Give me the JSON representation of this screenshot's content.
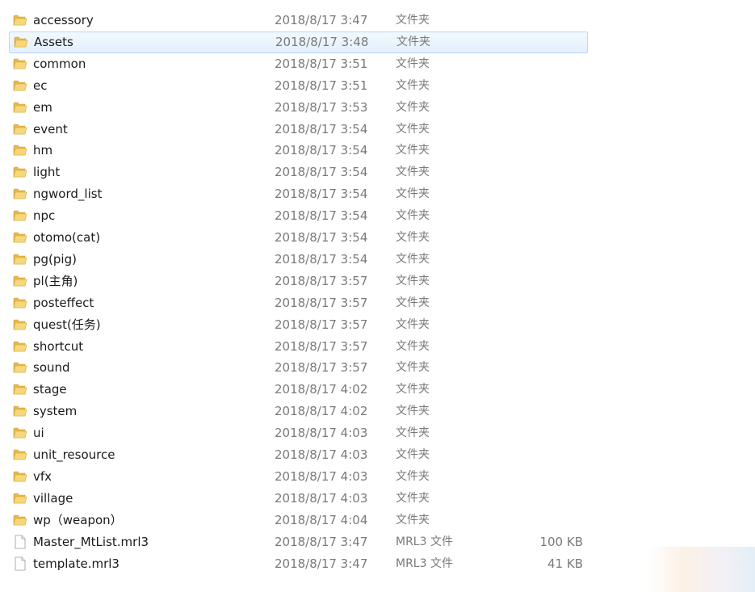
{
  "rows": [
    {
      "name": "accessory",
      "date": "2018/8/17 3:47",
      "type": "文件夹",
      "size": "",
      "kind": "folder",
      "selected": false
    },
    {
      "name": "Assets",
      "date": "2018/8/17 3:48",
      "type": "文件夹",
      "size": "",
      "kind": "folder",
      "selected": true
    },
    {
      "name": "common",
      "date": "2018/8/17 3:51",
      "type": "文件夹",
      "size": "",
      "kind": "folder",
      "selected": false
    },
    {
      "name": "ec",
      "date": "2018/8/17 3:51",
      "type": "文件夹",
      "size": "",
      "kind": "folder",
      "selected": false
    },
    {
      "name": "em",
      "date": "2018/8/17 3:53",
      "type": "文件夹",
      "size": "",
      "kind": "folder",
      "selected": false
    },
    {
      "name": "event",
      "date": "2018/8/17 3:54",
      "type": "文件夹",
      "size": "",
      "kind": "folder",
      "selected": false
    },
    {
      "name": "hm",
      "date": "2018/8/17 3:54",
      "type": "文件夹",
      "size": "",
      "kind": "folder",
      "selected": false
    },
    {
      "name": "light",
      "date": "2018/8/17 3:54",
      "type": "文件夹",
      "size": "",
      "kind": "folder",
      "selected": false
    },
    {
      "name": "ngword_list",
      "date": "2018/8/17 3:54",
      "type": "文件夹",
      "size": "",
      "kind": "folder",
      "selected": false
    },
    {
      "name": "npc",
      "date": "2018/8/17 3:54",
      "type": "文件夹",
      "size": "",
      "kind": "folder",
      "selected": false
    },
    {
      "name": "otomo(cat)",
      "date": "2018/8/17 3:54",
      "type": "文件夹",
      "size": "",
      "kind": "folder",
      "selected": false
    },
    {
      "name": "pg(pig)",
      "date": "2018/8/17 3:54",
      "type": "文件夹",
      "size": "",
      "kind": "folder",
      "selected": false
    },
    {
      "name": "pl(主角)",
      "date": "2018/8/17 3:57",
      "type": "文件夹",
      "size": "",
      "kind": "folder",
      "selected": false
    },
    {
      "name": "posteffect",
      "date": "2018/8/17 3:57",
      "type": "文件夹",
      "size": "",
      "kind": "folder",
      "selected": false
    },
    {
      "name": "quest(任务)",
      "date": "2018/8/17 3:57",
      "type": "文件夹",
      "size": "",
      "kind": "folder",
      "selected": false
    },
    {
      "name": "shortcut",
      "date": "2018/8/17 3:57",
      "type": "文件夹",
      "size": "",
      "kind": "folder",
      "selected": false
    },
    {
      "name": "sound",
      "date": "2018/8/17 3:57",
      "type": "文件夹",
      "size": "",
      "kind": "folder",
      "selected": false
    },
    {
      "name": "stage",
      "date": "2018/8/17 4:02",
      "type": "文件夹",
      "size": "",
      "kind": "folder",
      "selected": false
    },
    {
      "name": "system",
      "date": "2018/8/17 4:02",
      "type": "文件夹",
      "size": "",
      "kind": "folder",
      "selected": false
    },
    {
      "name": "ui",
      "date": "2018/8/17 4:03",
      "type": "文件夹",
      "size": "",
      "kind": "folder",
      "selected": false
    },
    {
      "name": "unit_resource",
      "date": "2018/8/17 4:03",
      "type": "文件夹",
      "size": "",
      "kind": "folder",
      "selected": false
    },
    {
      "name": "vfx",
      "date": "2018/8/17 4:03",
      "type": "文件夹",
      "size": "",
      "kind": "folder",
      "selected": false
    },
    {
      "name": "village",
      "date": "2018/8/17 4:03",
      "type": "文件夹",
      "size": "",
      "kind": "folder",
      "selected": false
    },
    {
      "name": "wp（weapon）",
      "date": "2018/8/17 4:04",
      "type": "文件夹",
      "size": "",
      "kind": "folder",
      "selected": false
    },
    {
      "name": "Master_MtList.mrl3",
      "date": "2018/8/17 3:47",
      "type": "MRL3 文件",
      "size": "100 KB",
      "kind": "file",
      "selected": false
    },
    {
      "name": "template.mrl3",
      "date": "2018/8/17 3:47",
      "type": "MRL3 文件",
      "size": "41 KB",
      "kind": "file",
      "selected": false
    }
  ],
  "colors": {
    "folder_body": "#e8b84a",
    "folder_front": "#f7d77c",
    "selection_border": "#b8d6fb",
    "secondary_text": "#7a7a7a"
  },
  "icons": {
    "folder": "folder-icon",
    "file": "file-icon"
  }
}
